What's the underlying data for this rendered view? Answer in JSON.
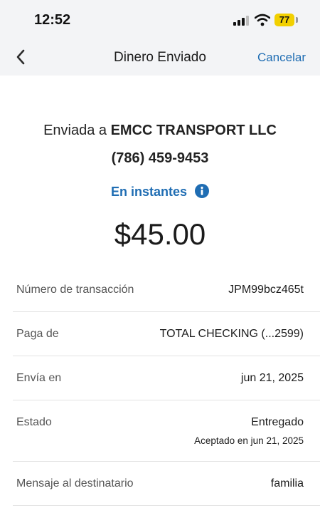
{
  "status_bar": {
    "time": "12:52",
    "battery": "77"
  },
  "nav": {
    "back_icon": "chevron-left-icon",
    "title": "Dinero Enviado",
    "cancel": "Cancelar"
  },
  "summary": {
    "sent_to_prefix": "Enviada a",
    "recipient": "EMCC TRANSPORT LLC",
    "phone": "(786) 459-9453",
    "speed": "En instantes",
    "info_icon": "info-icon",
    "amount": "$45.00"
  },
  "details": [
    {
      "label": "Número de transacción",
      "value": "JPM99bcz465t"
    },
    {
      "label": "Paga de",
      "value": "TOTAL CHECKING (...2599)"
    },
    {
      "label": "Envía en",
      "value": "jun 21, 2025"
    },
    {
      "label": "Estado",
      "value": "Entregado",
      "sub": "Aceptado en jun 21, 2025"
    },
    {
      "label": "Mensaje al destinatario",
      "value": "familia"
    }
  ],
  "colors": {
    "accent": "#1f6db3",
    "header_bg": "#f3f4f6",
    "battery": "#f2d000"
  }
}
